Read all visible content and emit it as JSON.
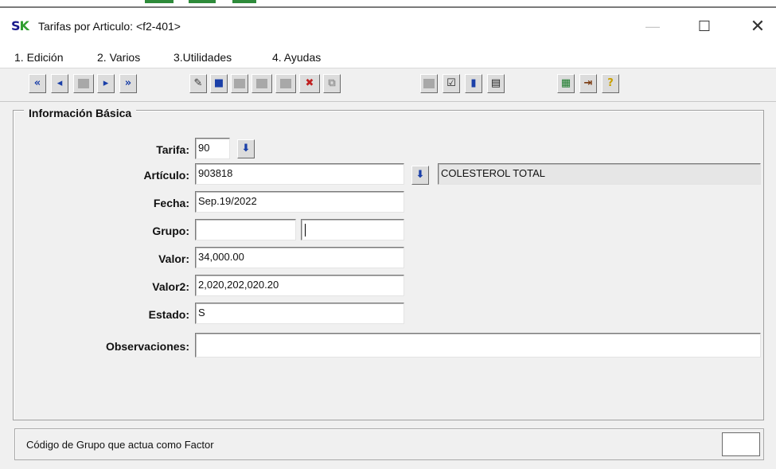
{
  "window": {
    "logo": {
      "s": "S",
      "k": "K"
    },
    "title": "Tarifas por Articulo: <f2-401>",
    "minimize_glyph": "—",
    "maximize_glyph": "☐",
    "close_glyph": "✕"
  },
  "menu": [
    "1. Edición",
    "2. Varios",
    "3.Utilidades",
    "4. Ayudas"
  ],
  "toolbar": {
    "nav": [
      {
        "icon": "first-record-icon",
        "glyph": "«"
      },
      {
        "icon": "previous-record-icon",
        "glyph": "◂"
      },
      {
        "icon": "record-disabled-icon",
        "glyph": "▪"
      },
      {
        "icon": "next-record-icon",
        "glyph": "▸"
      },
      {
        "icon": "last-record-icon",
        "glyph": "»"
      }
    ],
    "edit": [
      {
        "icon": "edit-pen-icon",
        "glyph": "✎"
      },
      {
        "icon": "save-disk-icon",
        "glyph": "■"
      },
      {
        "icon": "insert-disabled-icon",
        "glyph": ""
      },
      {
        "icon": "append-disabled-icon",
        "glyph": ""
      },
      {
        "icon": "blank-disabled-icon",
        "glyph": ""
      },
      {
        "icon": "delete-record-icon",
        "glyph": "✖"
      },
      {
        "icon": "copy-disabled-icon",
        "glyph": "⧉"
      }
    ],
    "tools": [
      {
        "icon": "print-disabled-icon",
        "glyph": ""
      },
      {
        "icon": "checkbox-report-icon",
        "glyph": "☑"
      },
      {
        "icon": "book-icon",
        "glyph": "▮"
      },
      {
        "icon": "form-view-icon",
        "glyph": "▤"
      }
    ],
    "misc": [
      {
        "icon": "calculator-icon",
        "glyph": "▦"
      },
      {
        "icon": "exit-door-icon",
        "glyph": "⇥"
      },
      {
        "icon": "help-question-icon",
        "glyph": "?"
      }
    ]
  },
  "form": {
    "legend": "Información Básica",
    "lookup_glyph": "⬇",
    "tarifa": {
      "label": "Tarifa:",
      "value": "90"
    },
    "articulo": {
      "label": "Artículo:",
      "value": "903818",
      "description": "COLESTEROL TOTAL"
    },
    "fecha": {
      "label": "Fecha:",
      "value": "Sep.19/2022"
    },
    "grupo": {
      "label": "Grupo:",
      "value1": "",
      "value2": ""
    },
    "valor": {
      "label": "Valor:",
      "value": "34,000.00"
    },
    "valor2": {
      "label": "Valor2:",
      "value": "2,020,202,020.20"
    },
    "estado": {
      "label": "Estado:",
      "value": "S"
    },
    "observaciones": {
      "label": "Observaciones:",
      "value": ""
    }
  },
  "status": {
    "text": "Código de Grupo que actua como Factor"
  },
  "colors": {
    "toolbar_icon_blue": "#1a3fa8",
    "logo_blue": "#1a1a8c",
    "logo_green": "#2f9e2f",
    "readonly_field": "#e6e6e6"
  }
}
